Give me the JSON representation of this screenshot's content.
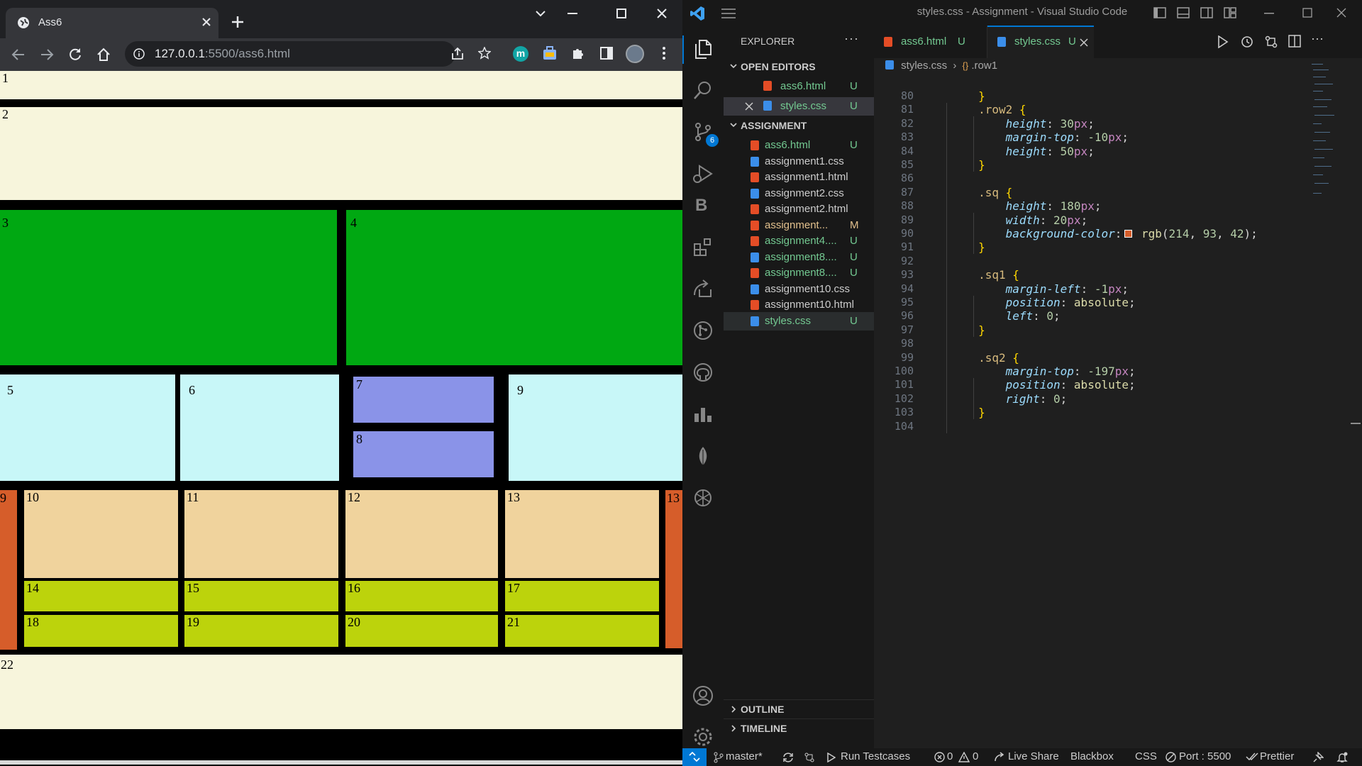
{
  "browser": {
    "tab_title": "Ass6",
    "url_host": "127.0.0.1",
    "url_rest": ":5500/ass6.html",
    "profile_initial": "m"
  },
  "page": {
    "boxes": [
      "1",
      "2",
      "3",
      "4",
      "5",
      "6",
      "7",
      "8",
      "9",
      "9",
      "10",
      "11",
      "12",
      "13",
      "13",
      "14",
      "15",
      "16",
      "17",
      "18",
      "19",
      "20",
      "21",
      "22"
    ]
  },
  "vscode": {
    "window_title": "styles.css - Assignment - Visual Studio Code",
    "explorer_title": "EXPLORER",
    "open_editors_label": "OPEN EDITORS",
    "open_editors": [
      {
        "name": "ass6.html",
        "badge": "U",
        "type": "html"
      },
      {
        "name": "styles.css",
        "badge": "U",
        "type": "css"
      }
    ],
    "folder_label": "ASSIGNMENT",
    "files": [
      {
        "name": "ass6.html",
        "badge": "U",
        "type": "html"
      },
      {
        "name": "assignment1.css",
        "badge": "",
        "type": "css"
      },
      {
        "name": "assignment1.html",
        "badge": "",
        "type": "html"
      },
      {
        "name": "assignment2.css",
        "badge": "",
        "type": "css"
      },
      {
        "name": "assignment2.html",
        "badge": "",
        "type": "html"
      },
      {
        "name": "assignment...",
        "badge": "M",
        "type": "html"
      },
      {
        "name": "assignment4....",
        "badge": "U",
        "type": "html"
      },
      {
        "name": "assignment8....",
        "badge": "U",
        "type": "css"
      },
      {
        "name": "assignment8....",
        "badge": "U",
        "type": "html"
      },
      {
        "name": "assignment10.css",
        "badge": "",
        "type": "css"
      },
      {
        "name": "assignment10.html",
        "badge": "",
        "type": "html"
      },
      {
        "name": "styles.css",
        "badge": "U",
        "type": "css"
      }
    ],
    "outline_label": "OUTLINE",
    "timeline_label": "TIMELINE",
    "scm_badge": "6",
    "editor_tabs": [
      {
        "name": "ass6.html",
        "badge": "U"
      },
      {
        "name": "styles.css",
        "badge": "U"
      }
    ],
    "breadcrumb": [
      "styles.css",
      ".row1"
    ],
    "line_numbers": [
      "80",
      "81",
      "82",
      "83",
      "84",
      "85",
      "86",
      "87",
      "88",
      "89",
      "90",
      "91",
      "92",
      "93",
      "94",
      "95",
      "96",
      "97",
      "98",
      "99",
      "100",
      "101",
      "102",
      "103",
      "104"
    ],
    "code_lines": [
      "        }",
      "        .row2 {",
      "            height: 30px;",
      "            margin-top: -10px;",
      "            height: 50px;",
      "        }",
      "",
      "        .sq {",
      "            height: 180px;",
      "            width: 20px;",
      "            background-color: rgb(214, 93, 42);",
      "        }",
      "",
      "        .sq1 {",
      "            margin-left: -1px;",
      "            position: absolute;",
      "            left: 0;",
      "        }",
      "",
      "        .sq2 {",
      "            margin-top: -197px;",
      "            position: absolute;",
      "            right: 0;",
      "        }",
      ""
    ],
    "status": {
      "branch": "master*",
      "run_testcases": "Run Testcases",
      "errors": "0",
      "warnings": "0",
      "live_share": "Live Share",
      "blackbox": "Blackbox",
      "language": "CSS",
      "port": "Port : 5500",
      "prettier": "Prettier"
    }
  },
  "colors": {
    "cream": "#f7f5dc",
    "green": "#00a812",
    "cyan": "#c8f7f8",
    "periwinkle": "#8a93e8",
    "orange": "#d65d2a",
    "peach": "#f0d39d",
    "lime": "#bcd30c",
    "vscode_accent": "#0078d4"
  }
}
